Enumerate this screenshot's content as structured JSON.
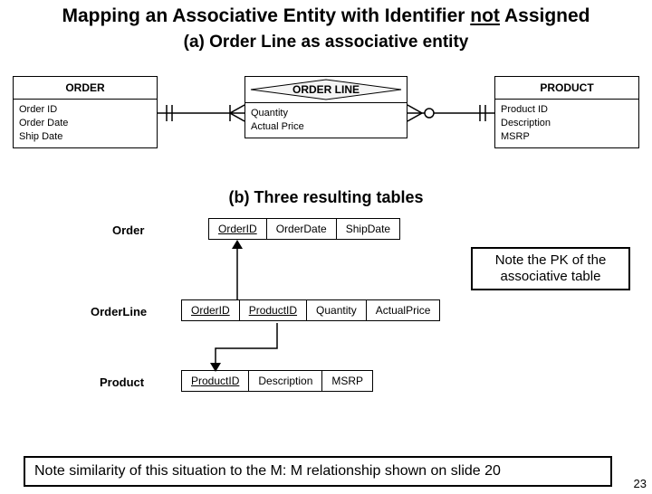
{
  "title_pre": "Mapping an Associative Entity with Identifier ",
  "title_not": "not",
  "title_post": " Assigned",
  "sub_a": "(a) Order Line as associative entity",
  "erd": {
    "order": {
      "name": "ORDER",
      "a1": "Order ID",
      "a2": "Order Date",
      "a3": "Ship Date"
    },
    "orderline": {
      "name": "ORDER LINE",
      "a1": "Quantity",
      "a2": "Actual Price"
    },
    "product": {
      "name": "PRODUCT",
      "a1": "Product ID",
      "a2": "Description",
      "a3": "MSRP"
    }
  },
  "sub_b": "(b) Three resulting tables",
  "tables": {
    "order": {
      "label": "Order",
      "c1": "OrderID",
      "c2": "OrderDate",
      "c3": "ShipDate"
    },
    "orderline": {
      "label": "OrderLine",
      "c1": "OrderID",
      "c2": "ProductID",
      "c3": "Quantity",
      "c4": "ActualPrice"
    },
    "product": {
      "label": "Product",
      "c1": "ProductID",
      "c2": "Description",
      "c3": "MSRP"
    }
  },
  "note_pk": "Note the PK of the associative table",
  "note_bottom": "Note similarity of this situation to the M: M relationship shown on slide 20",
  "page_num": "23"
}
